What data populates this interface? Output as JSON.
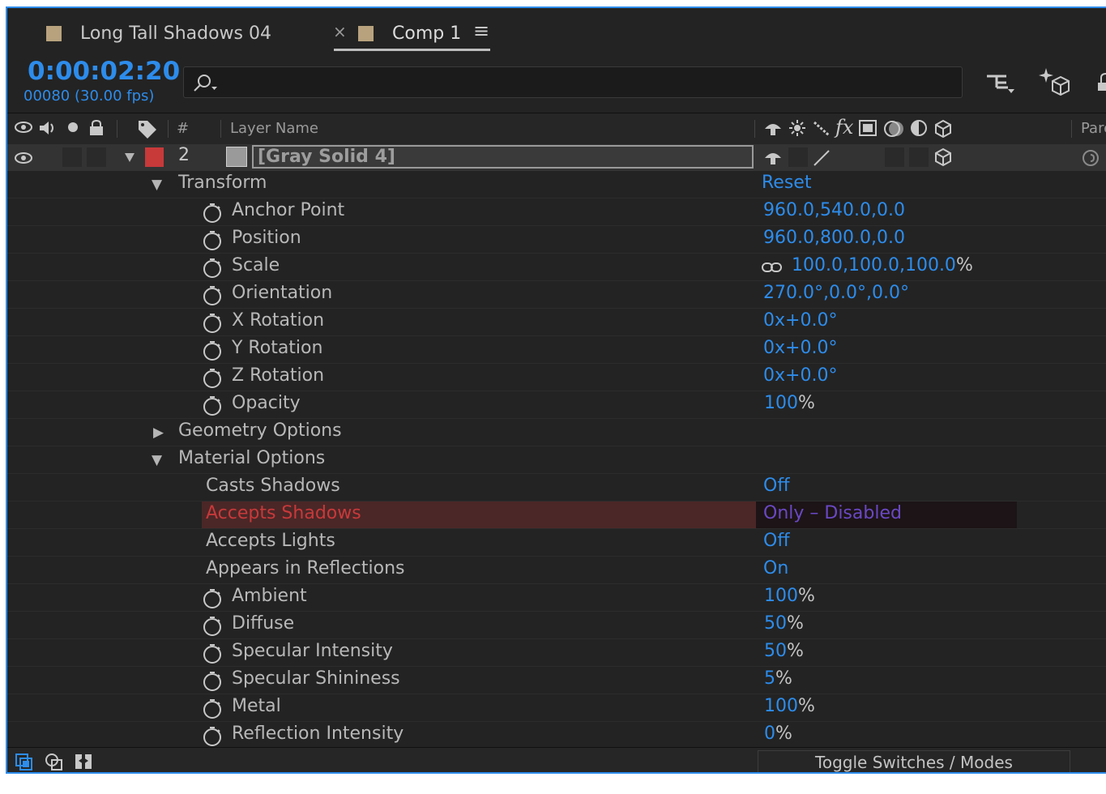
{
  "tabs": [
    {
      "label": "Long Tall Shadows 04",
      "color": "#b8a27e"
    },
    {
      "label": "Comp 1",
      "color": "#b8a27e",
      "active": true
    }
  ],
  "tab_close": "×",
  "tab_menu": "≡",
  "timecode": "0:00:02:20",
  "frame_info": "00080 (30.00 fps)",
  "search": {
    "placeholder": ""
  },
  "header": {
    "number_col": "#",
    "layer_name_col": "Layer Name",
    "fx_label": "fx",
    "parent_col": "Pare"
  },
  "layer": {
    "number": "2",
    "name": "[Gray Solid 4]",
    "label_color": "#c8393a"
  },
  "groups": {
    "transform": {
      "label": "Transform",
      "reset": "Reset"
    },
    "geometry": {
      "label": "Geometry Options"
    },
    "material": {
      "label": "Material Options"
    }
  },
  "transform_props": [
    {
      "name": "Anchor Point",
      "value": "960.0,540.0,0.0"
    },
    {
      "name": "Position",
      "value": "960.0,800.0,0.0"
    },
    {
      "name": "Scale",
      "value": "100.0,100.0,100.0",
      "unit": "%"
    },
    {
      "name": "Orientation",
      "value": "270.0°,0.0°,0.0°"
    },
    {
      "name": "X Rotation",
      "value": "0x+0.0°"
    },
    {
      "name": "Y Rotation",
      "value": "0x+0.0°"
    },
    {
      "name": "Z Rotation",
      "value": "0x+0.0°"
    },
    {
      "name": "Opacity",
      "value": "100",
      "unit": "%"
    }
  ],
  "material_props": [
    {
      "name": "Casts Shadows",
      "value": "Off"
    },
    {
      "name": "Accepts Shadows",
      "value": "Only – Disabled"
    },
    {
      "name": "Accepts Lights",
      "value": "Off"
    },
    {
      "name": "Appears in Reflections",
      "value": "On"
    },
    {
      "name": "Ambient",
      "value": "100",
      "unit": "%"
    },
    {
      "name": "Diffuse",
      "value": "50",
      "unit": "%"
    },
    {
      "name": "Specular Intensity",
      "value": "50",
      "unit": "%"
    },
    {
      "name": "Specular Shininess",
      "value": "5",
      "unit": "%"
    },
    {
      "name": "Metal",
      "value": "100",
      "unit": "%"
    },
    {
      "name": "Reflection Intensity",
      "value": "0",
      "unit": "%"
    }
  ],
  "footer": {
    "toggle_label": "Toggle Switches / Modes"
  },
  "colors": {
    "accent": "#2d8ceb",
    "highlight_name": "#c8393a",
    "highlight_value": "#6a48c4"
  }
}
